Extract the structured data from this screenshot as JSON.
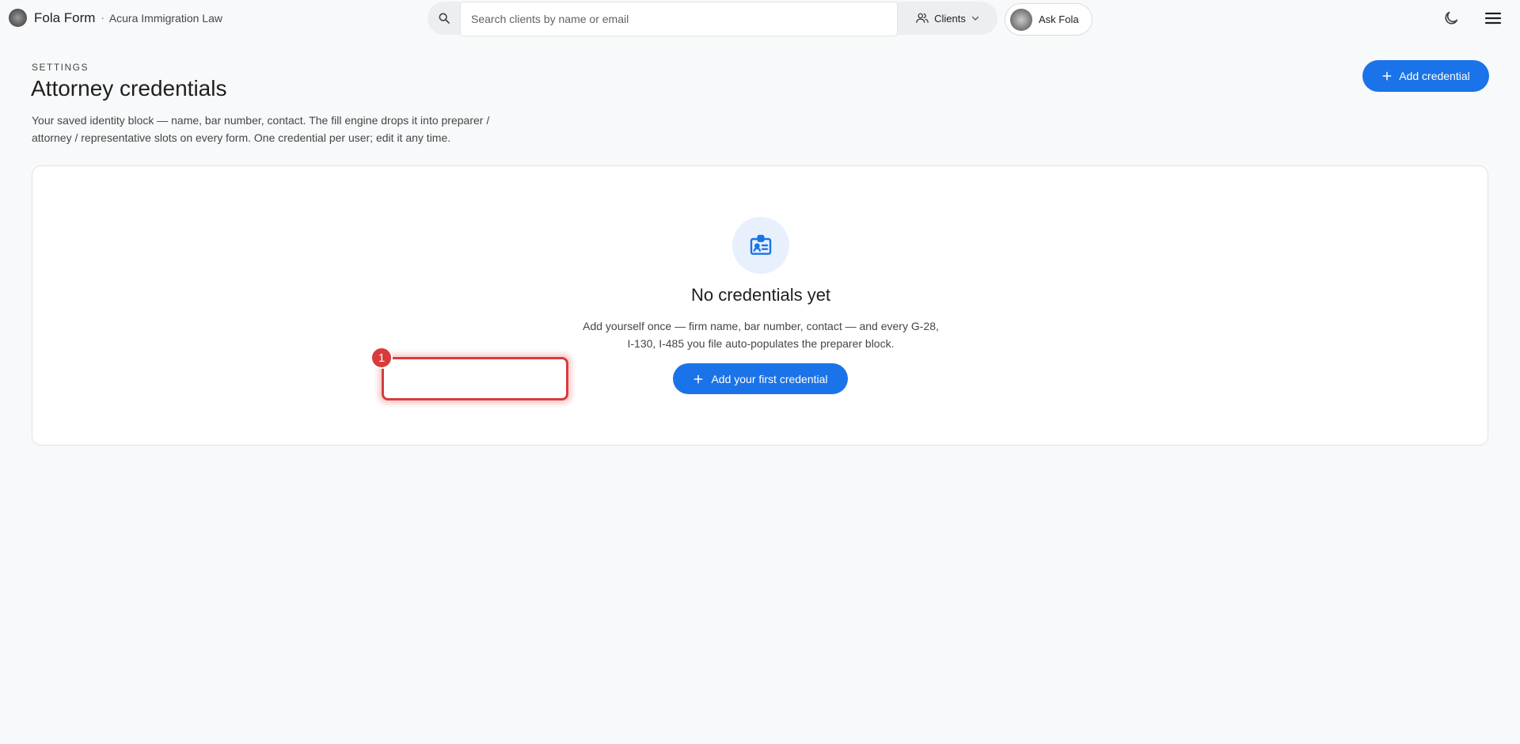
{
  "header": {
    "brand_name": "Fola Form",
    "brand_separator": "·",
    "org_name": "Acura Immigration Law",
    "search_placeholder": "Search clients by name or email",
    "search_value": "",
    "scope_label": "Clients",
    "ask_label": "Ask Fola"
  },
  "page": {
    "eyebrow": "SETTINGS",
    "title": "Attorney credentials",
    "description": "Your saved identity block — name, bar number, contact. The fill engine drops it into preparer / attorney / representative slots on every form. One credential per user; edit it any time.",
    "add_button_label": "Add credential"
  },
  "empty_state": {
    "icon": "id-badge-icon",
    "title": "No credentials yet",
    "description": "Add yourself once — firm name, bar number, contact — and every G-28, I-130, I-485 you file auto-populates the preparer block.",
    "button_label": "Add your first credential"
  },
  "annotation": {
    "badge_number": "1"
  },
  "colors": {
    "primary": "#1a73e8",
    "background": "#f8f9fa",
    "annotation": "#d93b3b",
    "icon_bg": "#e8f0fe"
  }
}
